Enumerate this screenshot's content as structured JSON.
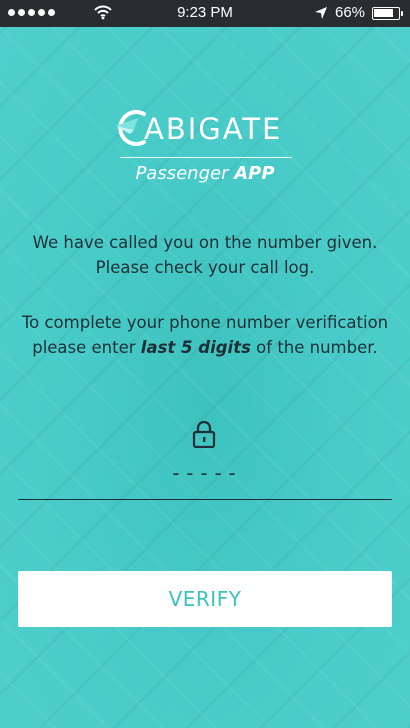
{
  "status_bar": {
    "time": "9:23 PM",
    "battery_percent": "66%",
    "signal_dots": 5,
    "icons": [
      "signal-dots",
      "wifi-icon",
      "location-arrow-icon",
      "battery-icon"
    ]
  },
  "brand": {
    "logo_text": "ABIGATE",
    "subtitle_light": "Passenger ",
    "subtitle_bold": "APP"
  },
  "message1": {
    "line1": "We have called you on the number given.",
    "line2": "Please check your call log."
  },
  "message2": {
    "before": "To complete your phone number verification please enter ",
    "emphasis": "last 5 digits",
    "after": " of the number."
  },
  "code_field": {
    "value": "",
    "placeholder": "-----"
  },
  "verify_button": {
    "label": "VERIFY"
  },
  "colors": {
    "background": "#45c9c6",
    "accent": "#3cc3c0",
    "text": "#1f2f36",
    "status_bar": "#2a2d30"
  }
}
